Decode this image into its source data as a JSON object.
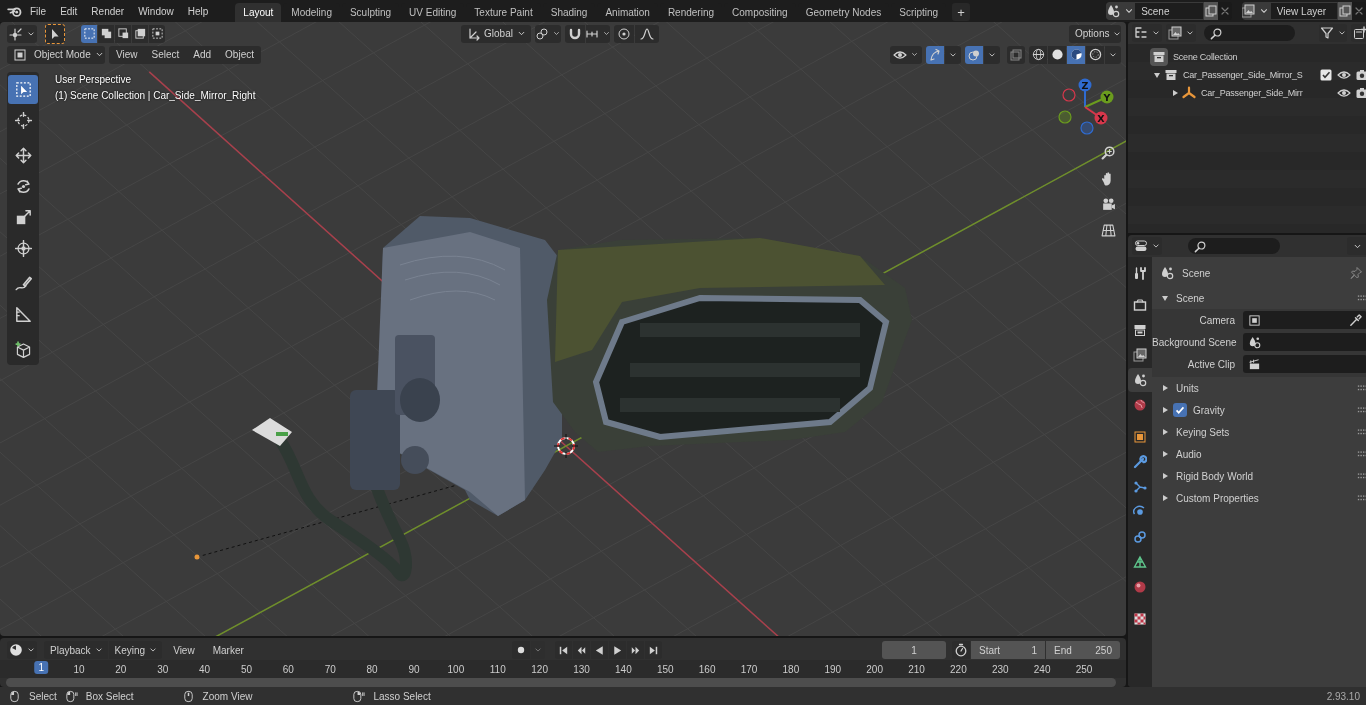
{
  "topbar": {
    "menus": [
      "File",
      "Edit",
      "Render",
      "Window",
      "Help"
    ],
    "workspaces": [
      {
        "label": "Layout",
        "selected": true
      },
      {
        "label": "Modeling",
        "selected": false
      },
      {
        "label": "Sculpting",
        "selected": false
      },
      {
        "label": "UV Editing",
        "selected": false
      },
      {
        "label": "Texture Paint",
        "selected": false
      },
      {
        "label": "Shading",
        "selected": false
      },
      {
        "label": "Animation",
        "selected": false
      },
      {
        "label": "Rendering",
        "selected": false
      },
      {
        "label": "Compositing",
        "selected": false
      },
      {
        "label": "Geometry Nodes",
        "selected": false
      },
      {
        "label": "Scripting",
        "selected": false
      }
    ],
    "add_tab": "+",
    "scene": "Scene",
    "view_layer": "View Layer"
  },
  "viewport": {
    "select_modes": [
      {
        "kind": "set",
        "selected": true
      },
      {
        "kind": "extend",
        "selected": false
      },
      {
        "kind": "subtract",
        "selected": false
      },
      {
        "kind": "invert",
        "selected": false
      },
      {
        "kind": "intersect",
        "selected": false
      }
    ],
    "orientation": "Global",
    "options": "Options",
    "mode": "Object Mode",
    "menus": [
      "View",
      "Select",
      "Add",
      "Object"
    ],
    "shading": [
      {
        "kind": "wireframe",
        "selected": false
      },
      {
        "kind": "solid",
        "selected": false
      },
      {
        "kind": "material",
        "selected": true
      },
      {
        "kind": "rendered",
        "selected": false
      }
    ],
    "info": [
      "User Perspective",
      "(1) Scene Collection | Car_Side_Mirror_Right"
    ],
    "tools": [
      {
        "kind": "select",
        "selected": true
      },
      {
        "kind": "cursor",
        "selected": false
      },
      {
        "kind": "move",
        "selected": false
      },
      {
        "kind": "rotate",
        "selected": false
      },
      {
        "kind": "scale",
        "selected": false
      },
      {
        "kind": "transform",
        "selected": false
      },
      {
        "kind": "annotate",
        "selected": false
      },
      {
        "kind": "measure",
        "selected": false
      },
      {
        "kind": "addcube",
        "selected": false
      }
    ],
    "gizmo": [
      {
        "label": "Z",
        "color": "#2f6bd0"
      },
      {
        "label": "Y",
        "color": "#6b9c1e"
      },
      {
        "label": "X",
        "color": "#d6374b"
      }
    ],
    "nav": [
      {
        "kind": "zoom"
      },
      {
        "kind": "hand"
      },
      {
        "kind": "camera"
      },
      {
        "kind": "grid"
      }
    ]
  },
  "outliner": {
    "tree": [
      {
        "label": "Scene Collection",
        "children": [
          {
            "label": "Car_Passenger_Side_Mirror_S",
            "expanded": true,
            "checked": true,
            "children": [
              {
                "label": "Car_Passenger_Side_Mirr",
                "expanded": false
              }
            ]
          }
        ]
      }
    ]
  },
  "properties": {
    "tabs": [
      {
        "kind": "tool",
        "selected": false
      },
      {
        "kind": "render",
        "selected": false
      },
      {
        "kind": "output",
        "selected": false
      },
      {
        "kind": "viewlayer",
        "selected": false
      },
      {
        "kind": "scene",
        "selected": true
      },
      {
        "kind": "world",
        "selected": false
      },
      {
        "kind": "object",
        "selected": false
      },
      {
        "kind": "modifier",
        "selected": false
      },
      {
        "kind": "particles",
        "selected": false
      },
      {
        "kind": "physics",
        "selected": false
      },
      {
        "kind": "constraints",
        "selected": false
      },
      {
        "kind": "data",
        "selected": false
      },
      {
        "kind": "materialtab",
        "selected": false
      },
      {
        "kind": "texture",
        "selected": false
      }
    ],
    "context": "Scene",
    "panels": [
      {
        "title": "Scene",
        "kind": "plain",
        "expanded": true,
        "fields": [
          {
            "label": "Camera",
            "kind": "camera"
          },
          {
            "label": "Background Scene",
            "kind": "scene"
          },
          {
            "label": "Active Clip",
            "kind": "clip"
          }
        ]
      },
      {
        "title": "Units",
        "kind": "plain",
        "expanded": false
      },
      {
        "title": "Gravity",
        "kind": "toggle",
        "expanded": false,
        "checked": true
      },
      {
        "title": "Keying Sets",
        "kind": "plain",
        "expanded": false
      },
      {
        "title": "Audio",
        "kind": "plain",
        "expanded": false
      },
      {
        "title": "Rigid Body World",
        "kind": "plain",
        "expanded": false
      },
      {
        "title": "Custom Properties",
        "kind": "plain",
        "expanded": false
      }
    ]
  },
  "timeline": {
    "menus": [
      {
        "label": "Playback",
        "kind": "dropdown"
      },
      {
        "label": "Keying",
        "kind": "dropdown"
      },
      {
        "label": "View",
        "kind": "menu"
      },
      {
        "label": "Marker",
        "kind": "menu"
      }
    ],
    "current_frame": "1",
    "start": {
      "label": "Start",
      "value": "1"
    },
    "end": {
      "label": "End",
      "value": "250"
    },
    "ruler": [
      {
        "label": "1",
        "selected": true
      },
      {
        "label": "10",
        "selected": false
      },
      {
        "label": "20",
        "selected": false
      },
      {
        "label": "30",
        "selected": false
      },
      {
        "label": "40",
        "selected": false
      },
      {
        "label": "50",
        "selected": false
      },
      {
        "label": "60",
        "selected": false
      },
      {
        "label": "70",
        "selected": false
      },
      {
        "label": "80",
        "selected": false
      },
      {
        "label": "90",
        "selected": false
      },
      {
        "label": "100",
        "selected": false
      },
      {
        "label": "110",
        "selected": false
      },
      {
        "label": "120",
        "selected": false
      },
      {
        "label": "130",
        "selected": false
      },
      {
        "label": "140",
        "selected": false
      },
      {
        "label": "150",
        "selected": false
      },
      {
        "label": "160",
        "selected": false
      },
      {
        "label": "170",
        "selected": false
      },
      {
        "label": "180",
        "selected": false
      },
      {
        "label": "190",
        "selected": false
      },
      {
        "label": "200",
        "selected": false
      },
      {
        "label": "210",
        "selected": false
      },
      {
        "label": "220",
        "selected": false
      },
      {
        "label": "230",
        "selected": false
      },
      {
        "label": "240",
        "selected": false
      },
      {
        "label": "250",
        "selected": false
      }
    ]
  },
  "status_bar": {
    "hints": [
      {
        "kind": "click",
        "label": "Select"
      },
      {
        "kind": "drag",
        "label": "Box Select"
      },
      {
        "kind": "middle",
        "label": "Zoom View"
      },
      {
        "kind": "lasso",
        "label": "Lasso Select"
      }
    ],
    "version": "2.93.10"
  }
}
